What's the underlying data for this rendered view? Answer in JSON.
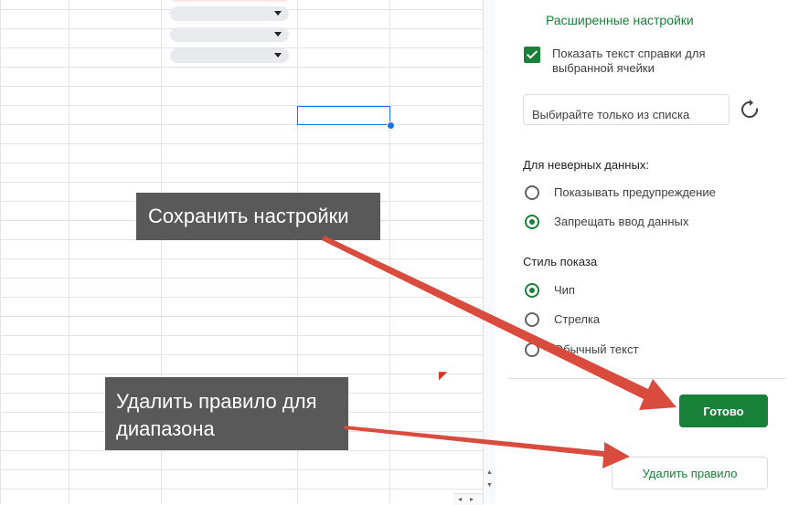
{
  "panel": {
    "section_title": "Расширенные настройки",
    "help_checkbox_label": "Показать текст справки для выбранной ячейки",
    "help_checkbox_checked": true,
    "input_value": "Выбирайте только из списка",
    "invalid_data": {
      "label": "Для неверных данных:",
      "options": [
        {
          "label": "Показывать предупреждение",
          "selected": false
        },
        {
          "label": "Запрещать ввод данных",
          "selected": true
        }
      ]
    },
    "display_style": {
      "label": "Стиль показа",
      "options": [
        {
          "label": "Чип",
          "selected": true
        },
        {
          "label": "Стрелка",
          "selected": false
        },
        {
          "label": "Обычный текст",
          "selected": false
        }
      ]
    },
    "done_label": "Готово",
    "delete_label": "Удалить правило"
  },
  "annotations": {
    "save_callout": "Сохранить настройки",
    "delete_callout": "Удалить правило для\nдиапазона"
  },
  "colors": {
    "accent_green": "#188038",
    "callout_bg": "#595959",
    "arrow_red": "#d94b3c",
    "selection_blue": "#1a73e8"
  },
  "icons": {
    "refresh": "refresh-icon",
    "dropdown": "chevron-down-icon"
  }
}
